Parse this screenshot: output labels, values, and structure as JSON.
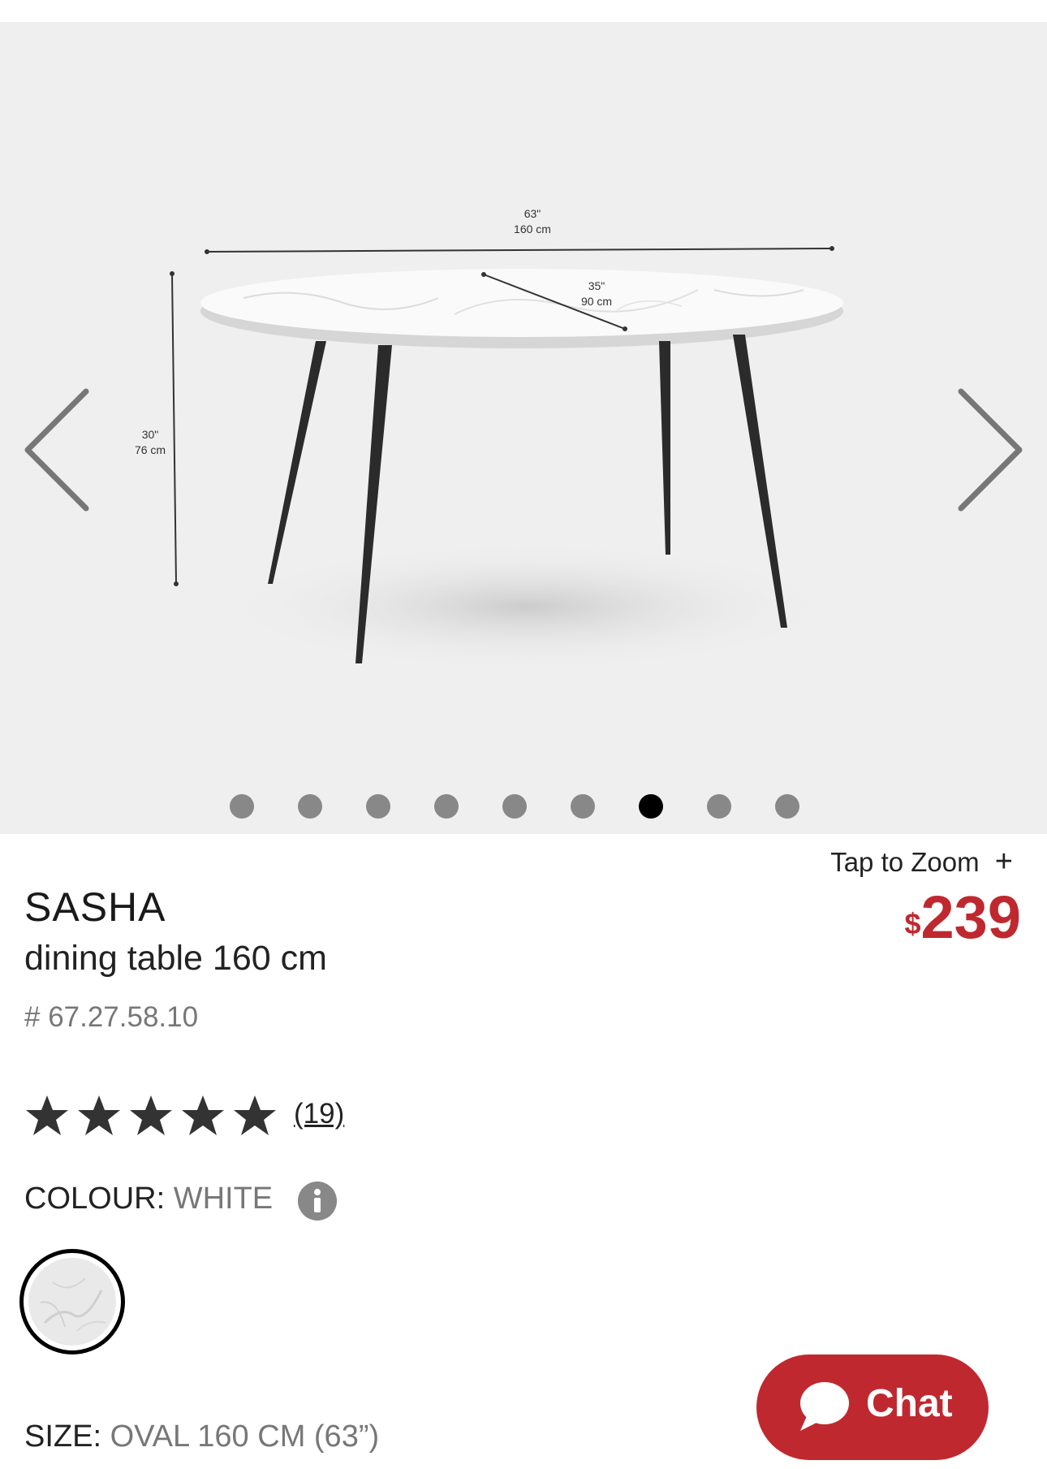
{
  "gallery": {
    "dimension_labels": {
      "width_in": "63\"",
      "width_cm": "160 cm",
      "depth_in": "35\"",
      "depth_cm": "90 cm",
      "height_in": "30\"",
      "height_cm": "76 cm"
    },
    "dots_count": 9,
    "active_dot_index": 6,
    "prev_icon": "chevron-left-icon",
    "next_icon": "chevron-right-icon"
  },
  "zoom": {
    "label": "Tap to Zoom",
    "icon": "+"
  },
  "product": {
    "brand": "SASHA",
    "subtitle": "dining table 160 cm",
    "sku": "# 67.27.58.10",
    "currency": "$",
    "price": "239",
    "price_color": "#c0282f"
  },
  "rating": {
    "stars": 5,
    "max_stars": 5,
    "review_count": "(19)"
  },
  "colour": {
    "label": "COLOUR: ",
    "value": "WHITE",
    "info_icon": "info-icon",
    "swatch": "white marble"
  },
  "size": {
    "label": "SIZE: ",
    "value": "OVAL 160 CM (63”)"
  },
  "chat": {
    "label": "Chat",
    "icon": "chat-bubble-icon"
  }
}
